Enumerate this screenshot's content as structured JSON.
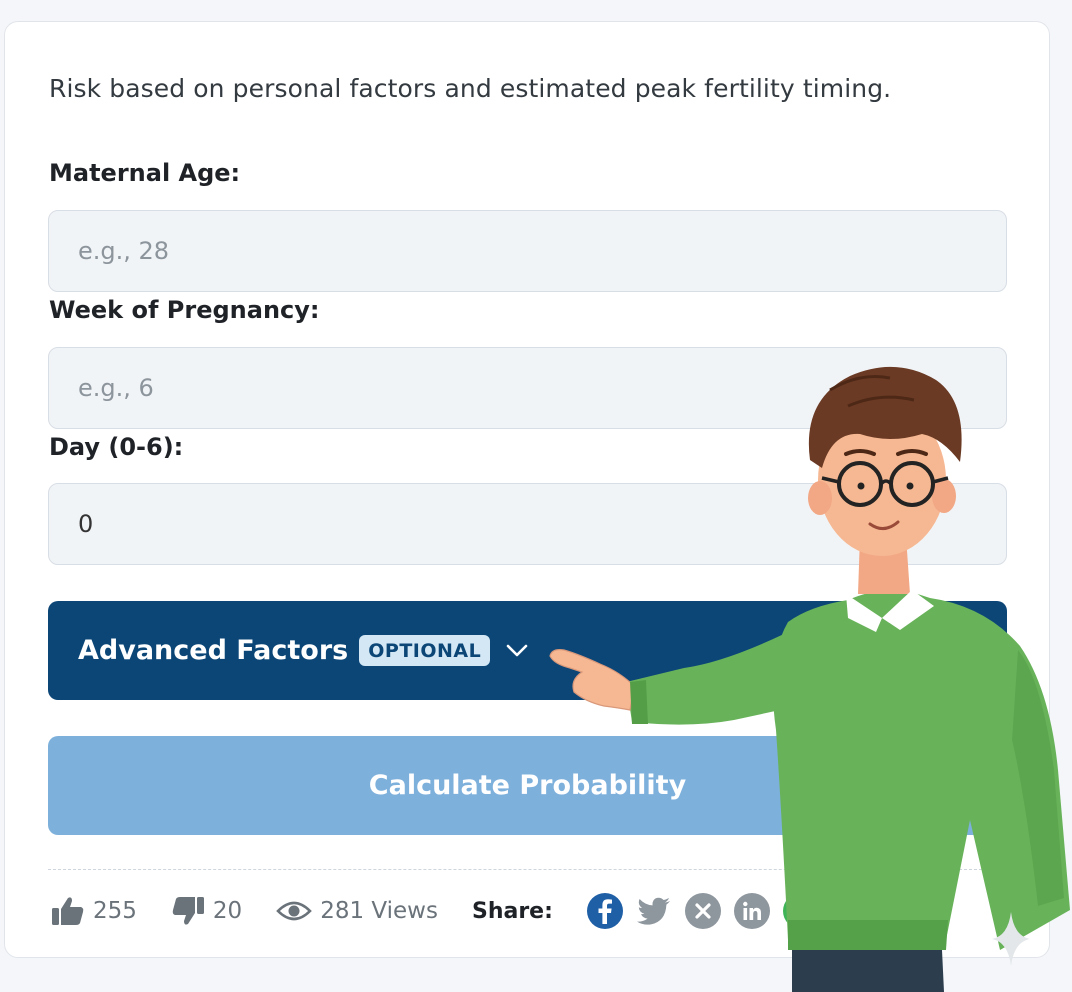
{
  "description": "Risk based on personal factors and estimated peak fertility timing.",
  "fields": [
    {
      "label": "Maternal Age:",
      "placeholder": "e.g., 28",
      "value": ""
    },
    {
      "label": "Week of Pregnancy:",
      "placeholder": "e.g., 6",
      "value": ""
    },
    {
      "label": "Day (0-6):",
      "placeholder": "",
      "value": "0"
    }
  ],
  "advanced": {
    "title": "Advanced Factors",
    "badge": "OPTIONAL",
    "icon": "chevron-down-icon"
  },
  "calculate_label": "Calculate Probability",
  "footer": {
    "likes": "255",
    "dislikes": "20",
    "views": "281 Views",
    "share_label": "Share:",
    "share_icons": [
      "facebook-icon",
      "twitter-icon",
      "x-icon",
      "linkedin-icon",
      "whatsapp-icon"
    ]
  },
  "colors": {
    "advanced_bg": "#0b4677",
    "calculate_bg": "#7eb0dc",
    "badge_bg": "#d3e7f5",
    "facebook": "#1f5fa6",
    "social_gray": "#8e969e"
  }
}
